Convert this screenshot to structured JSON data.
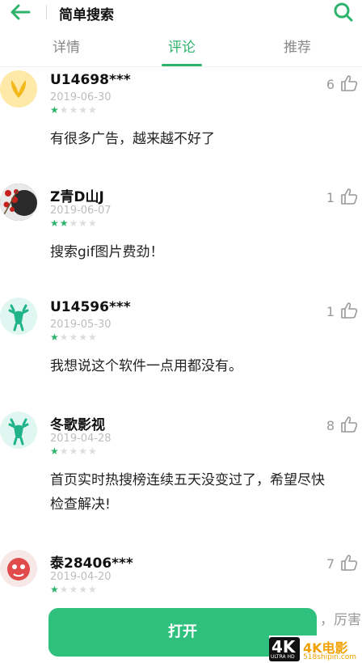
{
  "header": {
    "title": "简单搜索",
    "back_icon": "arrow-left-icon",
    "search_icon": "search-icon",
    "accent_color": "#2db36b"
  },
  "tabs": [
    {
      "label": "详情",
      "active": false
    },
    {
      "label": "评论",
      "active": true
    },
    {
      "label": "推荐",
      "active": false
    }
  ],
  "comments": [
    {
      "username": "U14698***",
      "date": "2019-06-30",
      "rating": 1,
      "likes": "6",
      "text": "有很多广告，越来越不好了"
    },
    {
      "username": "Z青D山J",
      "date": "2019-06-07",
      "rating": 2,
      "likes": "1",
      "text": "搜索gif图片费劲！"
    },
    {
      "username": "U14596***",
      "date": "2019-05-30",
      "rating": 1,
      "likes": "1",
      "text": "我想说这个软件一点用都没有。"
    },
    {
      "username": "冬歌影视",
      "date": "2019-04-28",
      "rating": 1,
      "likes": "8",
      "text": "首页实时热搜榜连续五天没变过了，希望尽快\n检查解决!"
    },
    {
      "username": "泰28406***",
      "date": "2019-04-20",
      "rating": 1,
      "likes": "7",
      "text": ""
    }
  ],
  "bottom": {
    "open_label": "打开",
    "peek_text": "，厉害"
  },
  "watermark": {
    "badge": "4K",
    "badge_sub": "ULTRA HD",
    "title": "4K电影",
    "url": "518shipin.com"
  }
}
